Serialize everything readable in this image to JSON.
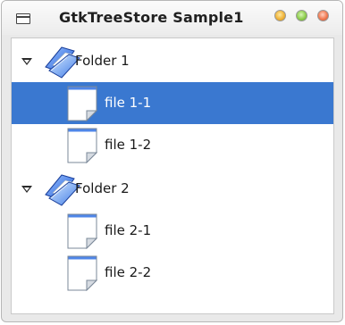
{
  "window": {
    "title": "GtkTreeStore Sample1",
    "controls": [
      "minimize",
      "maximize",
      "close"
    ]
  },
  "tree": {
    "rows": [
      {
        "label": "Folder 1",
        "type": "folder",
        "expanded": true,
        "depth": 0,
        "icon": "folder-icon"
      },
      {
        "label": "file 1-1",
        "type": "file",
        "depth": 1,
        "selected": true,
        "icon": "file-icon"
      },
      {
        "label": "file 1-2",
        "type": "file",
        "depth": 1,
        "icon": "file-icon"
      },
      {
        "label": "Folder 2",
        "type": "folder",
        "expanded": true,
        "depth": 0,
        "icon": "folder-icon"
      },
      {
        "label": "file 2-1",
        "type": "file",
        "depth": 1,
        "icon": "file-icon"
      },
      {
        "label": "file 2-2",
        "type": "file",
        "depth": 1,
        "icon": "file-icon"
      }
    ]
  },
  "colors": {
    "selection": "#3a78d0",
    "selection_text": "#ffffff"
  }
}
